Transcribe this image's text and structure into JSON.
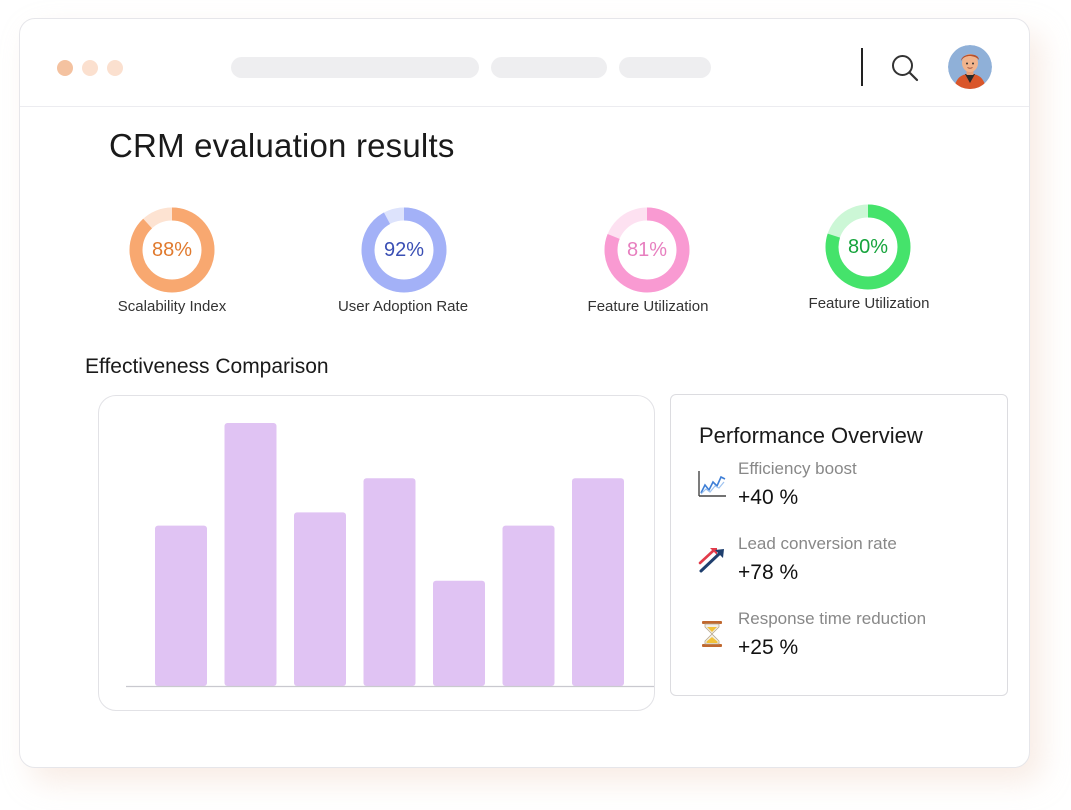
{
  "window": {
    "dot_colors": [
      "#f4c2a0",
      "#fbe0cf",
      "#fbe0cf"
    ]
  },
  "page": {
    "title": "CRM evaluation results"
  },
  "metrics": [
    {
      "percent_text": "88%",
      "value": 88,
      "label": "Scalability Index",
      "color": "#f8a870",
      "track": "#fde3d2",
      "text_color": "#e07a2e"
    },
    {
      "percent_text": "92%",
      "value": 92,
      "label": "User Adoption Rate",
      "color": "#a3b1f7",
      "track": "#dde3fc",
      "text_color": "#3a4fb4"
    },
    {
      "percent_text": "81%",
      "value": 81,
      "label": "Feature Utilization",
      "color": "#f99ad2",
      "track": "#fde1f1",
      "text_color": "#e77fbf"
    },
    {
      "percent_text": "80%",
      "value": 80,
      "label": "Feature Utilization",
      "color": "#45e36b",
      "track": "#ccf7d6",
      "text_color": "#16a43c"
    }
  ],
  "section": {
    "title": "Effectiveness Comparison"
  },
  "chart_data": {
    "type": "bar",
    "categories": [],
    "values": [
      61,
      100,
      66,
      79,
      40,
      61,
      79
    ],
    "ylim": [
      0,
      100
    ],
    "bar_color": "#e0c3f3",
    "grid": false,
    "axis_labels": false
  },
  "performance": {
    "title": "Performance Overview",
    "items": [
      {
        "name": "Efficiency boost",
        "value": "+40 %",
        "icon": "line-chart-icon"
      },
      {
        "name": "Lead conversion rate",
        "value": "+78 %",
        "icon": "trend-arrows-icon"
      },
      {
        "name": "Response time reduction",
        "value": "+25 %",
        "icon": "hourglass-icon"
      }
    ]
  }
}
